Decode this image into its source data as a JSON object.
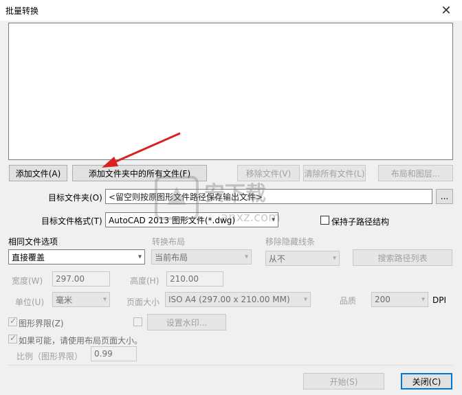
{
  "window": {
    "title": "批量转换",
    "close_glyph": "✕"
  },
  "file_buttons": {
    "add_file": "添加文件(A)",
    "add_folder": "添加文件夹中的所有文件(F)",
    "remove_file": "移除文件(V)",
    "clear_all": "清除所有文件(L)",
    "layout": "布局和图层..."
  },
  "target_folder": {
    "label": "目标文件夹(O)",
    "value": "<留空则按原图形文件路径保存输出文件>",
    "browse": "..."
  },
  "target_format": {
    "label": "目标文件格式(T)",
    "value": "AutoCAD 2013 图形文件(*.dwg)",
    "keep_path_label": "保持子路径结构"
  },
  "options": {
    "same_file_label": "相同文件选项",
    "same_file_value": "直接覆盖",
    "convert_layout_label": "转换布局",
    "convert_layout_value": "当前布局",
    "hidden_lines_label": "移除隐藏线条",
    "hidden_lines_value": "从不",
    "search_paths": "搜索路径列表"
  },
  "size": {
    "width_label": "宽度(W)",
    "width_value": "297.00",
    "height_label": "高度(H)",
    "height_value": "210.00",
    "unit_label": "单位(U)",
    "unit_value": "毫米",
    "page_size_label": "页面大小",
    "page_size_value": "ISO A4 (297.00 x 210.00 MM)",
    "quality_label": "品质",
    "quality_value": "200",
    "dpi_label": "DPI"
  },
  "extra": {
    "drawing_limits_label": "图形界限(Z)",
    "watermark_button": "设置水印...",
    "use_layout_label": "如果可能，请使用布局页面大小。",
    "scale_label": "比例（图形界限）",
    "scale_value": "0.99"
  },
  "footer": {
    "start": "开始(S)",
    "close": "关闭(C)"
  },
  "watermark_site": {
    "brand": "安下载",
    "domain": "anxz.com"
  },
  "colors": {
    "accent": "#0078d7",
    "arrow": "#d9211f"
  }
}
